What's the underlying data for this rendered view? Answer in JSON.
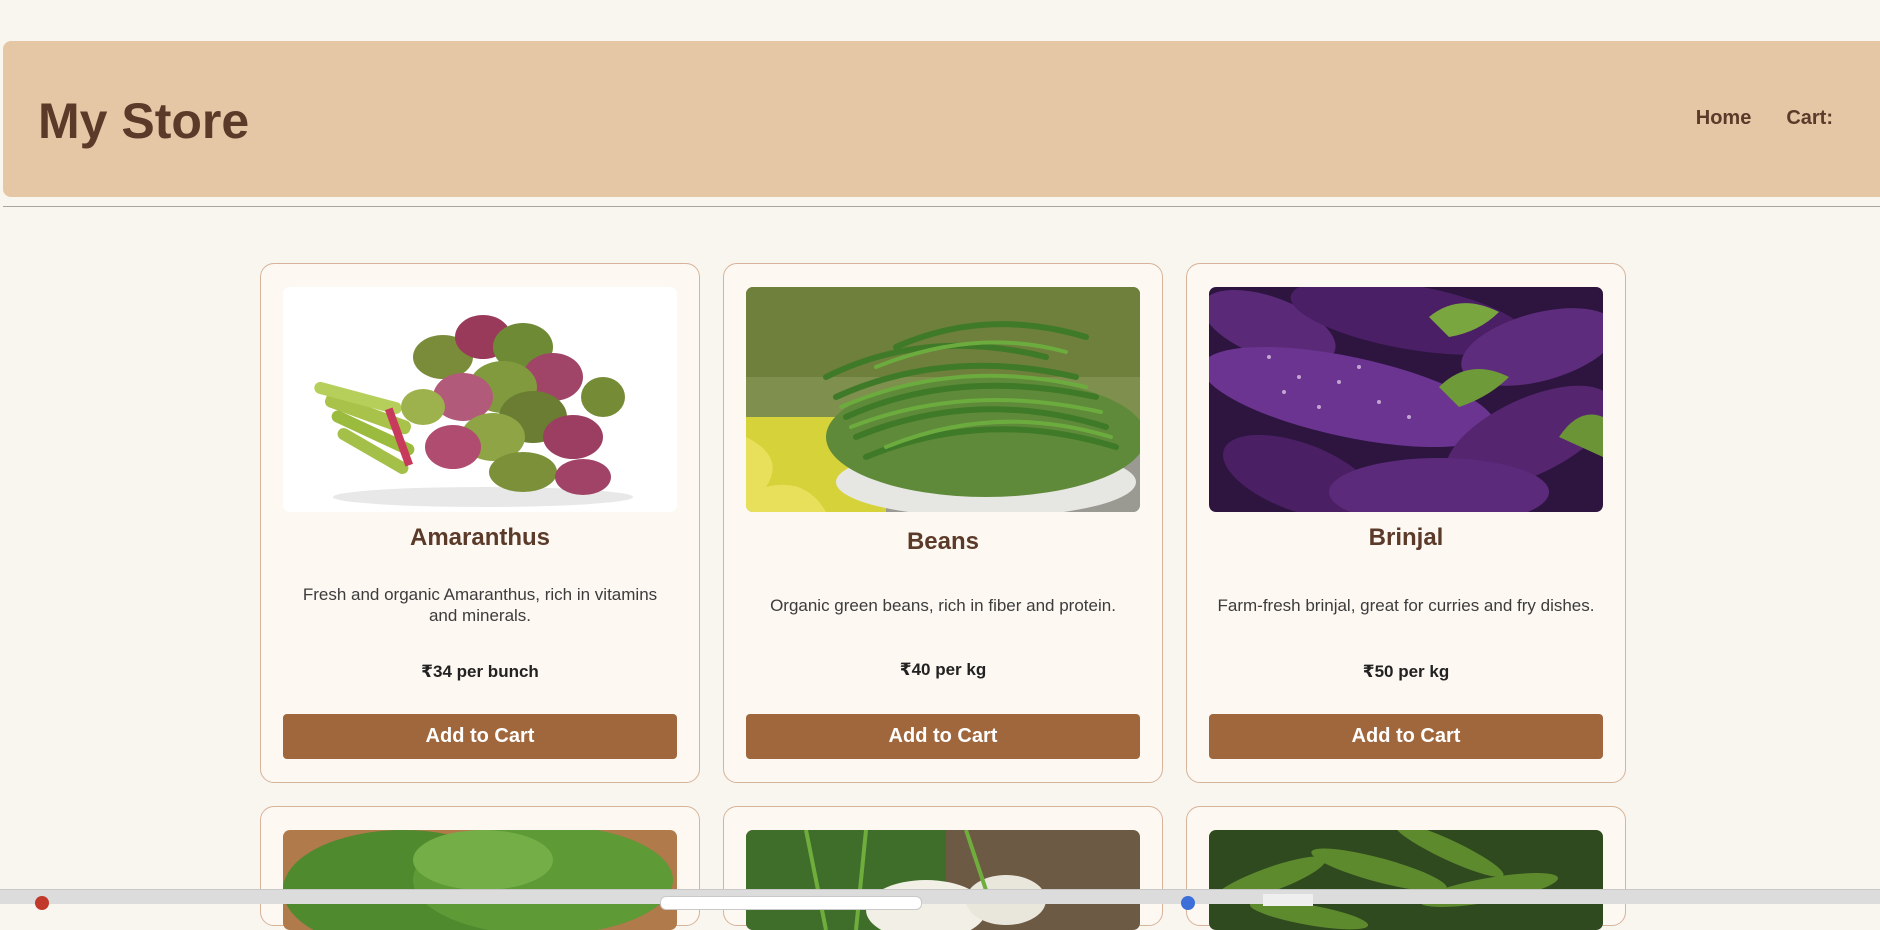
{
  "header": {
    "title": "My Store",
    "nav": {
      "home": "Home",
      "cart": "Cart:"
    }
  },
  "products": [
    {
      "name": "Amaranthus",
      "description": "Fresh and organic Amaranthus, rich in vitamins and minerals.",
      "price": "₹34 per bunch",
      "button": "Add to Cart",
      "image": "amaranthus-image"
    },
    {
      "name": "Beans",
      "description": "Organic green beans, rich in fiber and protein.",
      "price": "₹40 per kg",
      "button": "Add to Cart",
      "image": "beans-image"
    },
    {
      "name": "Brinjal",
      "description": "Farm-fresh brinjal, great for curries and fry dishes.",
      "price": "₹50 per kg",
      "button": "Add to Cart",
      "image": "brinjal-image"
    }
  ],
  "partial_products": [
    {
      "image": "leafy-greens-image"
    },
    {
      "image": "dill-cauliflower-image"
    },
    {
      "image": "okra-image"
    }
  ],
  "colors": {
    "accent": "#a0673d",
    "header_bg": "#e6c7a5",
    "text_brown": "#5b3a29",
    "page_bg": "#f9f5ef"
  }
}
